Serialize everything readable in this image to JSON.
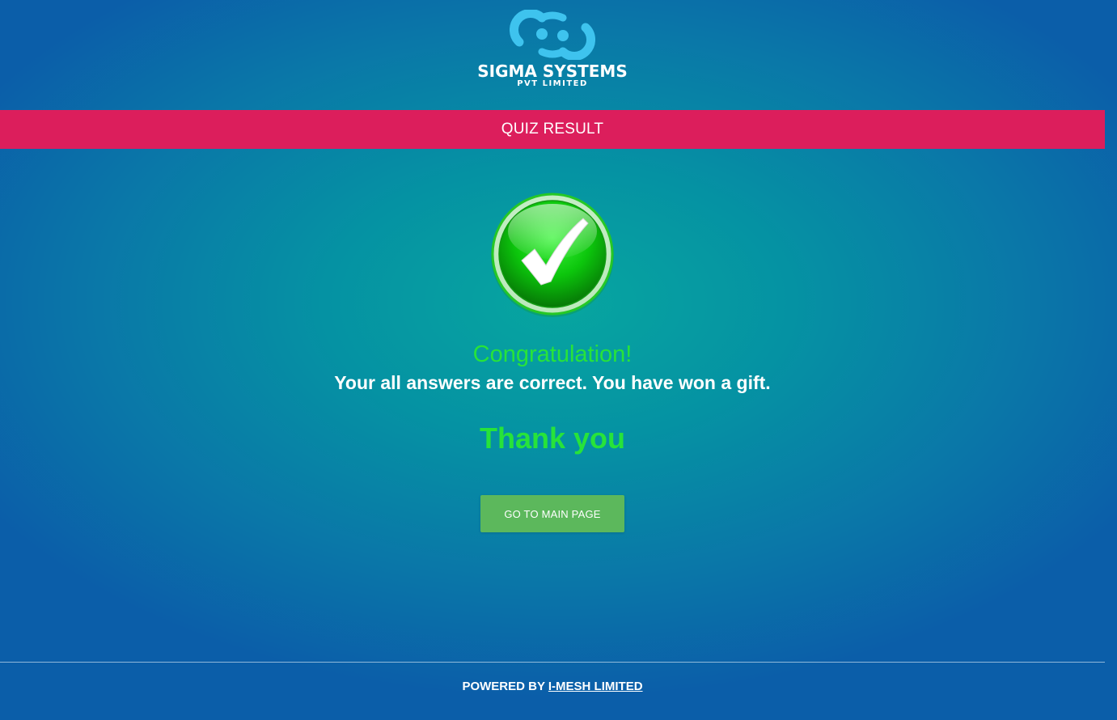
{
  "header": {
    "brand_name": "SIGMA SYSTEMS",
    "brand_sub": "PVT LIMITED",
    "logo_icon": "sigma-logo-icon",
    "logo_color": "#3ec3ee"
  },
  "title_bar": {
    "title": "QUIZ RESULT",
    "color": "#dc1e5c"
  },
  "result": {
    "icon": "green-check-icon",
    "congrats": "Congratulation!",
    "message": "Your all answers are correct. You have won a gift.",
    "thanks": "Thank you",
    "accent_color": "#27e33a"
  },
  "actions": {
    "main_page_label": "GO TO MAIN PAGE",
    "button_color": "#5cb85c"
  },
  "footer": {
    "powered_by": "POWERED BY",
    "company_link": "I-MESH LIMITED"
  }
}
